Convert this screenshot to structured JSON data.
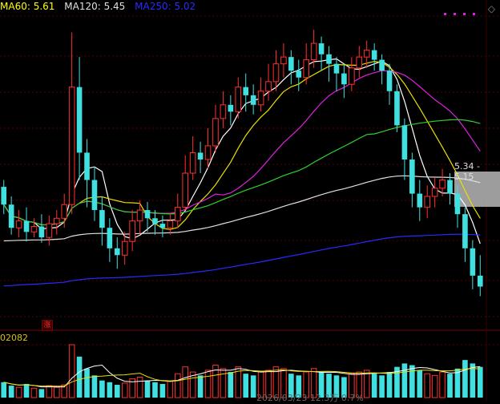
{
  "legend": {
    "ma60": {
      "label": "MA60: 5.61",
      "color": "#ffff00"
    },
    "ma120": {
      "label": "MA120: 5.45",
      "color": "#e0e0e0"
    },
    "ma250": {
      "label": "MA250: 5.02",
      "color": "#2a2aff"
    }
  },
  "volume_label": "02082",
  "price_tag": "5.34 - 5.15",
  "date_text": "2026/03/23 12.3万 0.7%",
  "badge_text": "涨",
  "top_right_icon": "diamond-icon",
  "colors": {
    "up": "#ff3030",
    "down": "#40e0e0",
    "grid": "#5a0000"
  },
  "chart_data": {
    "type": "candlestick",
    "series": [
      {
        "name": "MA60",
        "color": "#ffff00"
      },
      {
        "name": "MA120",
        "color": "#e0e0e0"
      },
      {
        "name": "MA250",
        "color": "#2a2aff"
      }
    ],
    "ohlc": [
      [
        5.35,
        5.22,
        5.4,
        5.15
      ],
      [
        5.22,
        5.05,
        5.28,
        5.0
      ],
      [
        5.05,
        5.1,
        5.18,
        4.98
      ],
      [
        5.1,
        5.02,
        5.2,
        4.95
      ],
      [
        5.02,
        5.06,
        5.12,
        4.98
      ],
      [
        5.06,
        4.98,
        5.15,
        4.94
      ],
      [
        4.98,
        5.08,
        5.14,
        4.92
      ],
      [
        5.08,
        5.12,
        5.18,
        5.0
      ],
      [
        5.12,
        5.22,
        5.3,
        5.05
      ],
      [
        5.22,
        6.08,
        6.48,
        5.15
      ],
      [
        6.08,
        5.6,
        6.3,
        5.4
      ],
      [
        5.6,
        5.4,
        5.7,
        5.2
      ],
      [
        5.4,
        5.18,
        5.5,
        5.1
      ],
      [
        5.18,
        5.05,
        5.28,
        4.92
      ],
      [
        5.05,
        4.9,
        5.12,
        4.8
      ],
      [
        4.9,
        4.85,
        4.98,
        4.75
      ],
      [
        4.85,
        4.95,
        5.02,
        4.78
      ],
      [
        4.95,
        5.1,
        5.18,
        4.88
      ],
      [
        5.1,
        5.18,
        5.25,
        5.0
      ],
      [
        5.18,
        5.12,
        5.24,
        5.02
      ],
      [
        5.12,
        5.08,
        5.18,
        5.0
      ],
      [
        5.08,
        5.05,
        5.14,
        4.98
      ],
      [
        5.05,
        5.1,
        5.16,
        5.0
      ],
      [
        5.1,
        5.2,
        5.3,
        5.05
      ],
      [
        5.2,
        5.45,
        5.58,
        5.18
      ],
      [
        5.45,
        5.6,
        5.72,
        5.4
      ],
      [
        5.6,
        5.55,
        5.68,
        5.45
      ],
      [
        5.55,
        5.65,
        5.78,
        5.48
      ],
      [
        5.65,
        5.85,
        5.95,
        5.6
      ],
      [
        5.85,
        5.95,
        6.05,
        5.78
      ],
      [
        5.95,
        5.9,
        6.02,
        5.8
      ],
      [
        5.9,
        6.08,
        6.15,
        5.85
      ],
      [
        6.08,
        6.02,
        6.18,
        5.9
      ],
      [
        6.02,
        5.95,
        6.1,
        5.88
      ],
      [
        5.95,
        6.05,
        6.15,
        5.9
      ],
      [
        6.05,
        6.12,
        6.25,
        5.98
      ],
      [
        6.12,
        6.25,
        6.35,
        6.05
      ],
      [
        6.25,
        6.3,
        6.4,
        6.15
      ],
      [
        6.3,
        6.2,
        6.35,
        6.1
      ],
      [
        6.2,
        6.15,
        6.28,
        6.05
      ],
      [
        6.15,
        6.28,
        6.4,
        6.1
      ],
      [
        6.28,
        6.4,
        6.5,
        6.22
      ],
      [
        6.4,
        6.32,
        6.45,
        6.2
      ],
      [
        6.32,
        6.25,
        6.38,
        6.12
      ],
      [
        6.25,
        6.18,
        6.3,
        6.05
      ],
      [
        6.18,
        6.1,
        6.25,
        6.0
      ],
      [
        6.1,
        6.22,
        6.3,
        6.05
      ],
      [
        6.22,
        6.3,
        6.38,
        6.15
      ],
      [
        6.3,
        6.35,
        6.42,
        6.22
      ],
      [
        6.35,
        6.28,
        6.4,
        6.2
      ],
      [
        6.28,
        6.2,
        6.32,
        6.1
      ],
      [
        6.2,
        6.05,
        6.25,
        5.95
      ],
      [
        6.05,
        5.8,
        6.1,
        5.75
      ],
      [
        5.8,
        5.55,
        5.85,
        5.4
      ],
      [
        5.55,
        5.3,
        5.6,
        5.2
      ],
      [
        5.3,
        5.2,
        5.4,
        5.1
      ],
      [
        5.2,
        5.28,
        5.36,
        5.12
      ],
      [
        5.28,
        5.34,
        5.42,
        5.2
      ],
      [
        5.34,
        5.4,
        5.48,
        5.28
      ],
      [
        5.4,
        5.3,
        5.45,
        5.22
      ],
      [
        5.3,
        5.15,
        5.36,
        5.05
      ],
      [
        5.15,
        4.9,
        5.2,
        4.8
      ],
      [
        4.9,
        4.7,
        4.96,
        4.6
      ],
      [
        4.7,
        4.62,
        4.85,
        4.55
      ]
    ],
    "volume": [
      18,
      14,
      12,
      16,
      11,
      10,
      14,
      12,
      15,
      62,
      48,
      34,
      26,
      20,
      18,
      15,
      17,
      22,
      24,
      20,
      18,
      16,
      19,
      28,
      36,
      30,
      26,
      32,
      38,
      34,
      30,
      36,
      28,
      26,
      30,
      32,
      36,
      34,
      28,
      26,
      30,
      34,
      30,
      28,
      26,
      24,
      28,
      30,
      32,
      28,
      26,
      30,
      36,
      40,
      38,
      32,
      28,
      26,
      30,
      28,
      34,
      44,
      40,
      36
    ]
  }
}
